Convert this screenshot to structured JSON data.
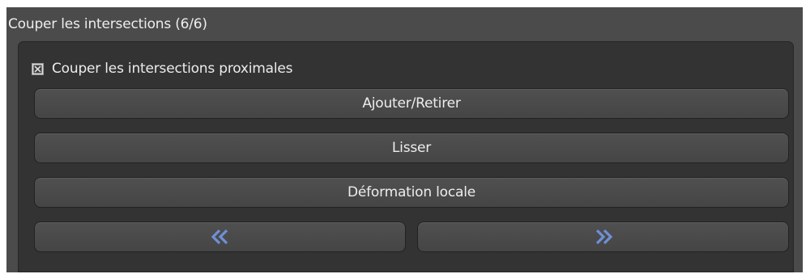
{
  "panel": {
    "title": "Couper les intersections (6/6)"
  },
  "checkbox": {
    "label": "Couper les intersections proximales",
    "checked": true
  },
  "buttons": {
    "add_remove": "Ajouter/Retirer",
    "smooth": "Lisser",
    "local_deform": "Déformation locale",
    "prev_icon": "double-chevron-left-icon",
    "next_icon": "double-chevron-right-icon"
  },
  "colors": {
    "panel_bg": "#4b4b4b",
    "inner_bg": "#333333",
    "button_bg": "#4a4a4a",
    "arrow_accent": "#6f8fd6",
    "text": "#ededed"
  }
}
